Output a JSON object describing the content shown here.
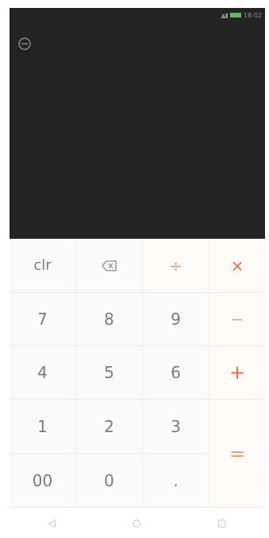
{
  "status_bar": {
    "signal": "",
    "time": "18:02",
    "battery_color": "#5bbf5b"
  },
  "display": {
    "history_icon": "history-clock-icon",
    "expression": "",
    "result": ""
  },
  "keys": {
    "clear": "clr",
    "backspace_icon": "backspace-icon",
    "divide": "÷",
    "multiply": "×",
    "minus": "−",
    "plus": "+",
    "equals": "=",
    "n7": "7",
    "n8": "8",
    "n9": "9",
    "n4": "4",
    "n5": "5",
    "n6": "6",
    "n1": "1",
    "n2": "2",
    "n3": "3",
    "n00": "00",
    "n0": "0",
    "dot": "."
  },
  "navbar": {
    "back": "◁",
    "home": "○",
    "recents": "□"
  },
  "colors": {
    "display_bg": "#232323",
    "operator": "#f0a070",
    "operator_active": "#ee6a4a",
    "digit": "#7a7a7a"
  }
}
